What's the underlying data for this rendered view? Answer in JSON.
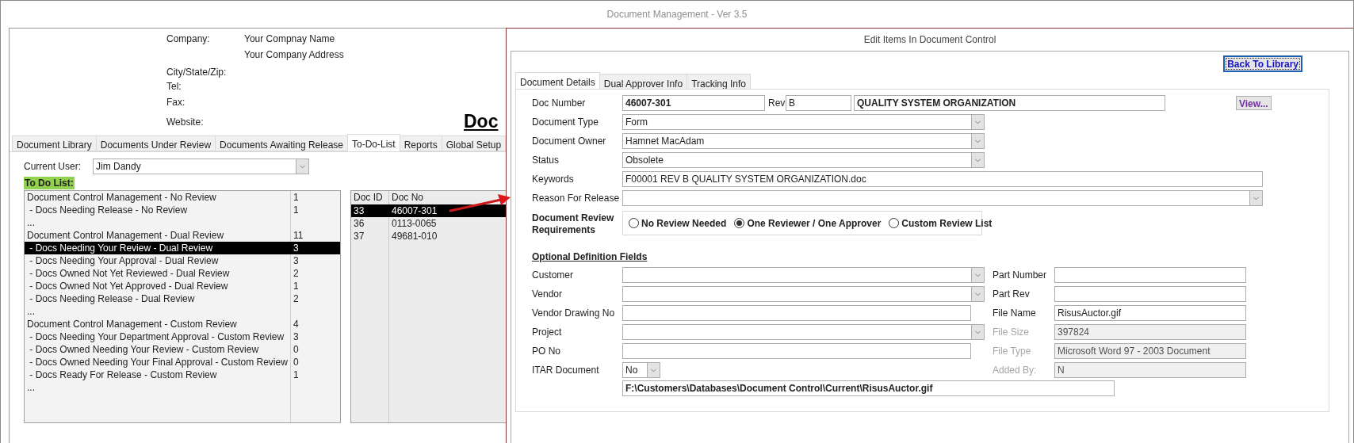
{
  "window": {
    "title": "Document Management - Ver 3.5"
  },
  "company_header": {
    "fields": [
      {
        "label": "Company:",
        "value": "Your Compnay Name"
      },
      {
        "value": "Your Company Address"
      },
      {
        "label": "City/State/Zip:"
      },
      {
        "label": "Tel:"
      },
      {
        "label": "Fax:"
      },
      {
        "label": "Website:"
      }
    ],
    "title_fragment": "Doc"
  },
  "main_tabs": [
    {
      "label": "Document Library",
      "selected": false
    },
    {
      "label": "Documents Under Review",
      "selected": false
    },
    {
      "label": "Documents Awaiting Release",
      "selected": false
    },
    {
      "label": "To-Do-List",
      "selected": true
    },
    {
      "label": "Reports",
      "selected": false
    },
    {
      "label": "Global Setup",
      "selected": false
    }
  ],
  "current_user": {
    "label": "Current User:",
    "value": "Jim Dandy"
  },
  "todo_list": {
    "title": "To Do List:",
    "rows": [
      {
        "text": "Document Control Management - No Review",
        "count": "1",
        "selected": false
      },
      {
        "text": " - Docs Needing Release - No Review",
        "count": "1",
        "selected": false
      },
      {
        "text": "...",
        "selected": false
      },
      {
        "text": "Document Control Management - Dual Review",
        "count": "11",
        "selected": false
      },
      {
        "text": " - Docs Needing Your Review - Dual Review",
        "count": "3",
        "selected": true
      },
      {
        "text": " - Docs Needing Your Approval - Dual Review",
        "count": "3",
        "selected": false
      },
      {
        "text": " - Docs Owned Not Yet Reviewed - Dual Review",
        "count": "2",
        "selected": false
      },
      {
        "text": " - Docs Owned Not Yet Approved - Dual Review",
        "count": "1",
        "selected": false
      },
      {
        "text": " - Docs Needing Release - Dual Review",
        "count": "2",
        "selected": false
      },
      {
        "text": "...",
        "selected": false
      },
      {
        "text": "Document Control Management - Custom Review",
        "count": "4",
        "selected": false
      },
      {
        "text": " - Docs Needing Your Department Approval - Custom Review",
        "count": "3",
        "selected": false
      },
      {
        "text": " - Docs Owned Needing Your Review - Custom Review",
        "count": "0",
        "selected": false
      },
      {
        "text": " - Docs Owned Needing Your Final Approval - Custom Review",
        "count": "0",
        "selected": false
      },
      {
        "text": " - Docs Ready For Release - Custom Review",
        "count": "1",
        "selected": false
      },
      {
        "text": "...",
        "selected": false
      }
    ]
  },
  "doc_table": {
    "columns": [
      "Doc ID",
      "Doc No"
    ],
    "rows": [
      {
        "doc_id": "33",
        "doc_no": "46007-301",
        "selected": true
      },
      {
        "doc_id": "36",
        "doc_no": "0113-0065",
        "selected": false
      },
      {
        "doc_id": "37",
        "doc_no": "49681-010",
        "selected": false
      }
    ]
  },
  "dialog": {
    "title": "Edit Items In Document Control",
    "back_button": "Back To Library",
    "tabs": [
      {
        "label": "Document Details",
        "selected": true
      },
      {
        "label": "Dual Approver Info",
        "selected": false
      },
      {
        "label": "Tracking Info",
        "selected": false
      }
    ],
    "doc_number": {
      "label": "Doc Number",
      "value": "46007-301"
    },
    "rev": {
      "label": "Rev",
      "value": "B"
    },
    "doc_title": "QUALITY SYSTEM ORGANIZATION",
    "view_button": "View...",
    "fields": [
      {
        "label": "Document Type",
        "value": "Form",
        "kind": "combo"
      },
      {
        "label": "Document Owner",
        "value": "Hamnet MacAdam",
        "kind": "combo"
      },
      {
        "label": "Status",
        "value": "Obsolete",
        "kind": "combo"
      },
      {
        "label": "Keywords",
        "value": "F00001 REV B QUALITY SYSTEM ORGANIZATION.doc",
        "kind": "wide_text"
      },
      {
        "label": "Reason For Release",
        "kind": "wide_combo"
      }
    ],
    "review_requirements": {
      "label": "Document Review Requirements",
      "options": [
        {
          "label": "No Review Needed",
          "selected": false
        },
        {
          "label": "One Reviewer / One Approver",
          "selected": true
        },
        {
          "label": "Custom Review List",
          "selected": false
        }
      ]
    },
    "optional": {
      "heading": "Optional Definition Fields",
      "left_fields": [
        {
          "label": "Customer",
          "kind": "combo"
        },
        {
          "label": "Vendor",
          "kind": "combo"
        },
        {
          "label": "Vendor Drawing No",
          "kind": "text"
        },
        {
          "label": "Project",
          "kind": "combo"
        },
        {
          "label": "PO No",
          "kind": "text"
        },
        {
          "label": "ITAR Document",
          "value": "No",
          "kind": "small_combo"
        }
      ],
      "right_fields": [
        {
          "label": "Part Number",
          "disabled": false
        },
        {
          "label": "Part Rev",
          "disabled": false
        },
        {
          "label": "File Name",
          "value": "RisusAuctor.gif",
          "disabled": false
        },
        {
          "label": "File Size",
          "value": "397824",
          "disabled": true
        },
        {
          "label": "File Type",
          "value": "Microsoft Word 97 - 2003 Document",
          "disabled": true
        },
        {
          "label": "Added By:",
          "value": "N",
          "disabled": true
        }
      ],
      "path": "F:\\Customers\\Databases\\Document Control\\Current\\RisusAuctor.gif"
    }
  }
}
